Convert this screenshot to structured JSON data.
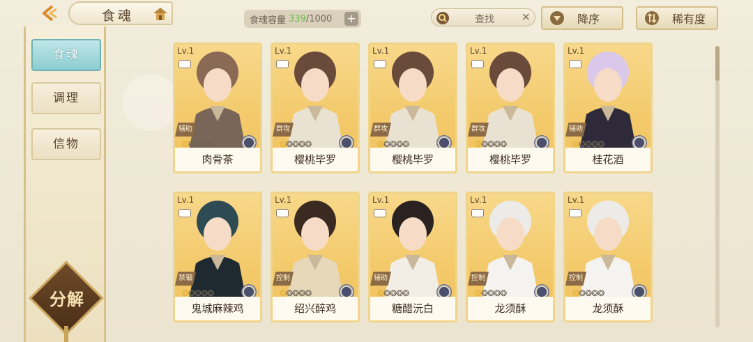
{
  "header": {
    "title": "食魂",
    "capacity_label": "食魂容量",
    "capacity_current": "339",
    "capacity_max": "/1000",
    "search_placeholder": "查找",
    "sort_desc_label": "降序",
    "sort_rarity_label": "稀有度"
  },
  "sidebar": {
    "items": [
      {
        "label": "食魂",
        "active": true
      },
      {
        "label": "调理",
        "active": false
      },
      {
        "label": "信物",
        "active": false
      }
    ],
    "decompose_label": "分解"
  },
  "cards": [
    {
      "level": "Lv.1",
      "role": "辅助",
      "stars": 1,
      "name": "肉骨茶",
      "hair": "#8a6a55",
      "robe": "#7a6658"
    },
    {
      "level": "Lv.1",
      "role": "群攻",
      "stars": 1,
      "name": "樱桃毕罗",
      "hair": "#6a4a3a",
      "robe": "#e9e2d2"
    },
    {
      "level": "Lv.1",
      "role": "群攻",
      "stars": 1,
      "name": "樱桃毕罗",
      "hair": "#6a4a3a",
      "robe": "#e9e2d2"
    },
    {
      "level": "Lv.1",
      "role": "群攻",
      "stars": 1,
      "name": "樱桃毕罗",
      "hair": "#6a4a3a",
      "robe": "#e9e2d2"
    },
    {
      "level": "Lv.1",
      "role": "辅助",
      "stars": 1,
      "name": "桂花酒",
      "hair": "#d9c8ea",
      "robe": "#2e2a3a"
    },
    {
      "level": "Lv.1",
      "role": "禁锢",
      "stars": 1,
      "name": "鬼城麻辣鸡",
      "hair": "#2e4a52",
      "robe": "#1e2a30"
    },
    {
      "level": "Lv.1",
      "role": "控制",
      "stars": 1,
      "name": "绍兴醉鸡",
      "hair": "#3a2a22",
      "robe": "#e6d8b8"
    },
    {
      "level": "Lv.1",
      "role": "辅助",
      "stars": 1,
      "name": "糖醋沅白",
      "hair": "#2a2220",
      "robe": "#f2eee6"
    },
    {
      "level": "Lv.1",
      "role": "控制",
      "stars": 1,
      "name": "龙须酥",
      "hair": "#ecebe8",
      "robe": "#f4f3f0"
    },
    {
      "level": "Lv.1",
      "role": "控制",
      "stars": 1,
      "name": "龙须酥",
      "hair": "#ecebe8",
      "robe": "#f4f3f0"
    }
  ]
}
